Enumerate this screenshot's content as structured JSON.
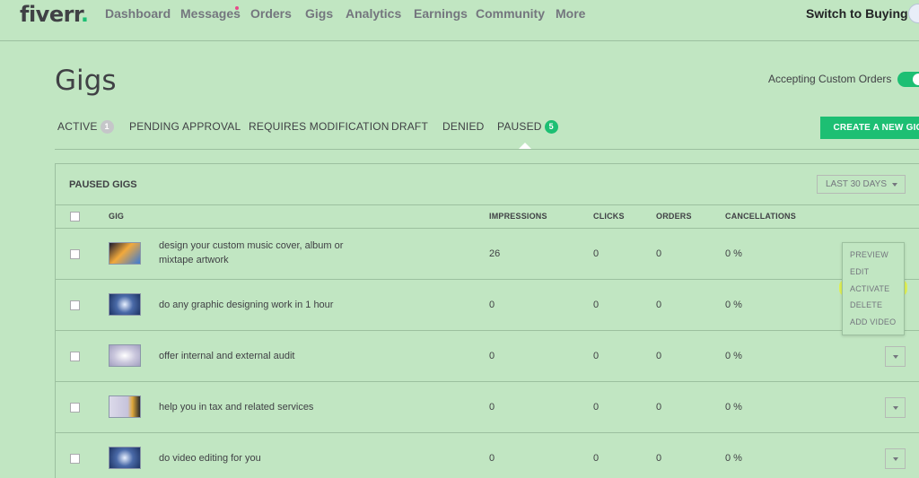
{
  "logo": {
    "text": "fiverr",
    "dot": "."
  },
  "nav": {
    "items": [
      "Dashboard",
      "Messages",
      "Orders",
      "Gigs",
      "Analytics",
      "Earnings",
      "Community",
      "More"
    ],
    "switch_label": "Switch to Buying"
  },
  "header": {
    "title": "Gigs",
    "custom_orders_label": "Accepting Custom Orders",
    "custom_orders_on": true
  },
  "tabs": [
    {
      "label": "ACTIVE",
      "count": "1"
    },
    {
      "label": "PENDING APPROVAL"
    },
    {
      "label": "REQUIRES MODIFICATION"
    },
    {
      "label": "DRAFT"
    },
    {
      "label": "DENIED"
    },
    {
      "label": "PAUSED",
      "count": "5",
      "selected": true
    }
  ],
  "create_button": "CREATE A NEW GIG",
  "panel": {
    "title": "PAUSED GIGS",
    "range": "LAST 30 DAYS",
    "columns": [
      "GIG",
      "IMPRESSIONS",
      "CLICKS",
      "ORDERS",
      "CANCELLATIONS"
    ]
  },
  "rows": [
    {
      "title": "design your custom music cover, album or mixtape artwork",
      "impressions": "26",
      "clicks": "0",
      "orders": "0",
      "cancellations": "0 %"
    },
    {
      "title": "do any graphic designing work in 1 hour",
      "impressions": "0",
      "clicks": "0",
      "orders": "0",
      "cancellations": "0 %"
    },
    {
      "title": "offer internal and external audit",
      "impressions": "0",
      "clicks": "0",
      "orders": "0",
      "cancellations": "0 %"
    },
    {
      "title": "help you in tax and related services",
      "impressions": "0",
      "clicks": "0",
      "orders": "0",
      "cancellations": "0 %"
    },
    {
      "title": "do video editing for you",
      "impressions": "0",
      "clicks": "0",
      "orders": "0",
      "cancellations": "0 %"
    }
  ],
  "menu": [
    "PREVIEW",
    "EDIT",
    "ACTIVATE",
    "DELETE",
    "ADD VIDEO"
  ],
  "colors": {
    "brand": "#1dbf73",
    "background": "#c1e6c2",
    "highlight": "#e2f24a",
    "text": "#404145"
  }
}
